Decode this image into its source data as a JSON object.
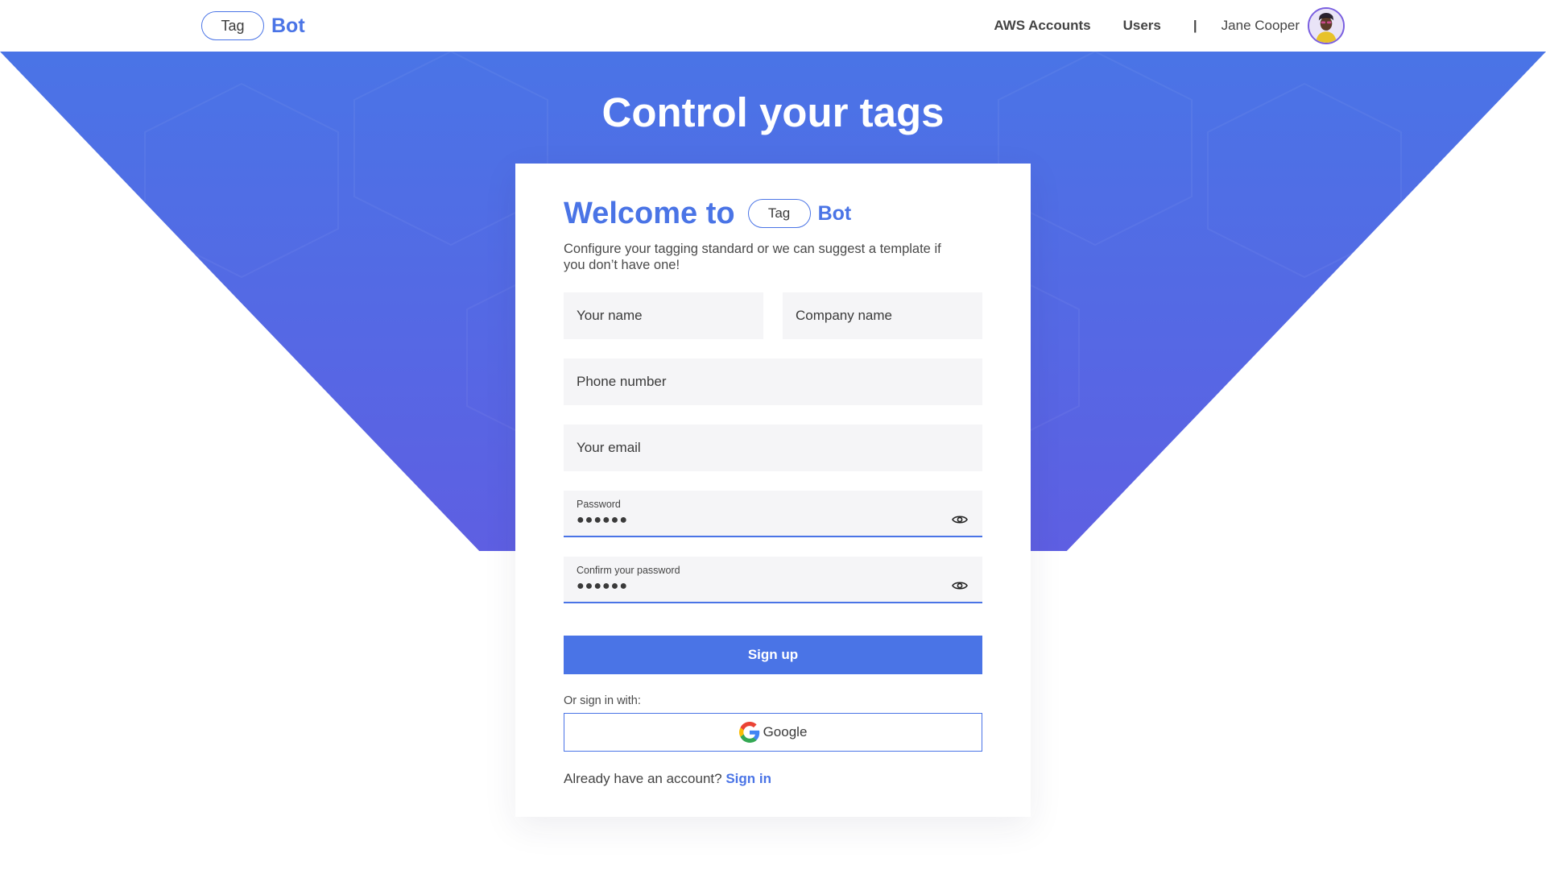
{
  "header": {
    "logo_tag": "Tag",
    "logo_bot": "Bot",
    "nav": {
      "aws_accounts": "AWS Accounts",
      "users": "Users",
      "separator": "|",
      "user_name": "Jane Cooper"
    }
  },
  "hero": {
    "title": "Control your tags"
  },
  "card": {
    "welcome": "Welcome to",
    "logo_tag": "Tag",
    "logo_bot": "Bot",
    "subtitle_line1": "Configure your tagging standard or we can suggest a template if",
    "subtitle_line2": "you don’t have one!",
    "fields": {
      "your_name": "Your name",
      "company_name": "Company name",
      "phone_number": "Phone number",
      "your_email": "Your email",
      "password_label": "Password",
      "password_value": "●●●●●●",
      "confirm_label": "Confirm your password",
      "confirm_value": "●●●●●●"
    },
    "signup_label": "Sign up",
    "or_sign_in_with": "Or sign in with:",
    "google_label": "Google",
    "already_text": "Already have an account?",
    "sign_in_link": "Sign in"
  },
  "icons": {
    "eye": "eye-icon",
    "google": "google-icon",
    "avatar": "avatar"
  },
  "colors": {
    "accent": "#4a74e6",
    "hero_top": "#4a74e6",
    "hero_bottom": "#6a52e0",
    "field_bg": "#f5f5f7"
  }
}
